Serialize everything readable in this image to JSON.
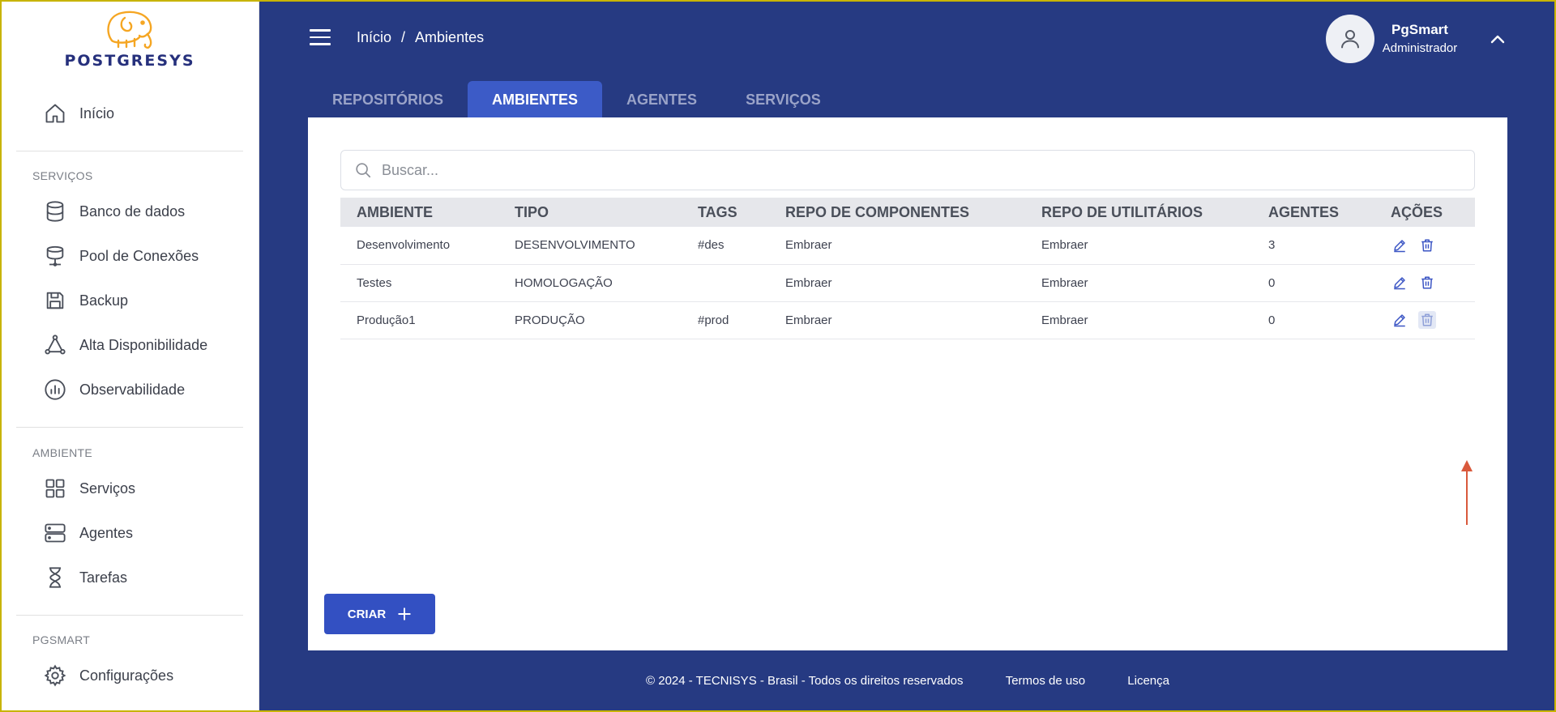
{
  "brand": {
    "name": "POSTGRESYS"
  },
  "sidebar": {
    "home": {
      "label": "Início",
      "icon": "home-icon"
    },
    "sections": [
      {
        "label": "SERVIÇOS",
        "items": [
          {
            "label": "Banco de dados",
            "icon": "database-icon"
          },
          {
            "label": "Pool de Conexões",
            "icon": "pool-icon"
          },
          {
            "label": "Backup",
            "icon": "save-icon"
          },
          {
            "label": "Alta Disponibilidade",
            "icon": "triangle-nodes-icon"
          },
          {
            "label": "Observabilidade",
            "icon": "chart-icon"
          }
        ]
      },
      {
        "label": "AMBIENTE",
        "items": [
          {
            "label": "Serviços",
            "icon": "grid-icon"
          },
          {
            "label": "Agentes",
            "icon": "server-icon"
          },
          {
            "label": "Tarefas",
            "icon": "hourglass-icon"
          }
        ]
      },
      {
        "label": "PGSMART",
        "items": [
          {
            "label": "Configurações",
            "icon": "gear-icon"
          }
        ]
      }
    ]
  },
  "header": {
    "breadcrumb": {
      "home": "Início",
      "separator": "/",
      "current": "Ambientes"
    },
    "user": {
      "name": "PgSmart",
      "role": "Administrador"
    }
  },
  "tabs": [
    {
      "label": "REPOSITÓRIOS",
      "active": false
    },
    {
      "label": "AMBIENTES",
      "active": true
    },
    {
      "label": "AGENTES",
      "active": false
    },
    {
      "label": "SERVIÇOS",
      "active": false
    }
  ],
  "search": {
    "placeholder": "Buscar..."
  },
  "table": {
    "columns": [
      "AMBIENTE",
      "TIPO",
      "TAGS",
      "REPO DE COMPONENTES",
      "REPO DE UTILITÁRIOS",
      "AGENTES",
      "AÇÕES"
    ],
    "rows": [
      [
        "Desenvolvimento",
        "DESENVOLVIMENTO",
        "#des",
        "Embraer",
        "Embraer",
        "3"
      ],
      [
        "Testes",
        "HOMOLOGAÇÃO",
        "",
        "Embraer",
        "Embraer",
        "0"
      ],
      [
        "Produção1",
        "PRODUÇÃO",
        "#prod",
        "Embraer",
        "Embraer",
        "0"
      ]
    ]
  },
  "create_button": {
    "label": "CRIAR"
  },
  "footer": {
    "copyright": "© 2024 - TECNISYS - Brasil - Todos os direitos reservados",
    "terms": "Termos de uso",
    "license": "Licença"
  },
  "colors": {
    "header_bg": "#263a82",
    "active_tab": "#3c5bc7",
    "primary": "#3350c2",
    "action_icon": "#3b55c4",
    "annotation_arrow": "#d9593c",
    "logo_orange": "#f5a623"
  }
}
